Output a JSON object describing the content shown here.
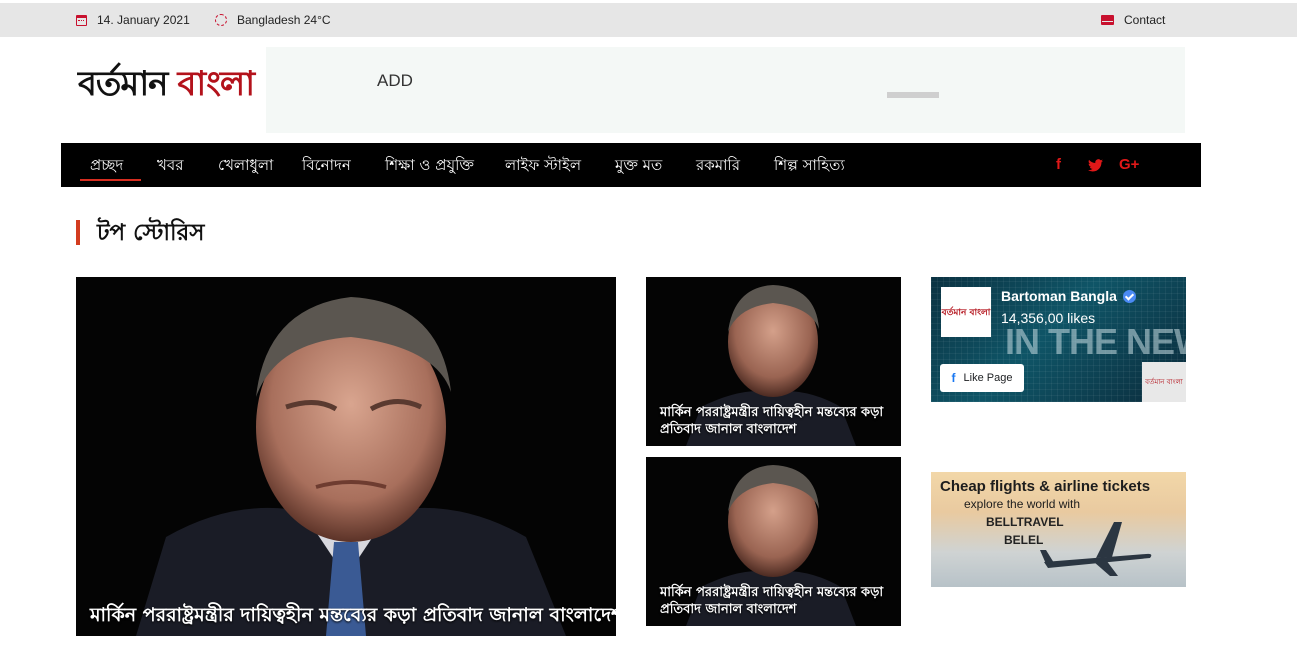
{
  "topbar": {
    "date": "14. January 2021",
    "weather": "Bangladesh 24°C",
    "contact": "Contact"
  },
  "header": {
    "logo_part1": "বর্তমান",
    "logo_part2": "বাংলা",
    "ad_text": "ADD"
  },
  "nav": {
    "items": [
      "প্রচ্ছদ",
      "খবর",
      "খেলাধুলা",
      "বিনোদন",
      "শিক্ষা ও প্রযুক্তি",
      "লাইফ স্টাইল",
      "মুক্ত মত",
      "রকমারি",
      "শিল্প সাহিত্য"
    ],
    "social": [
      "f",
      "t",
      "G+"
    ]
  },
  "section": {
    "title": "টপ স্টোরিস"
  },
  "stories": [
    {
      "headline": "মার্কিন পররাষ্ট্রমন্ত্রীর দায়িত্বহীন মন্তব্যের কড়া প্রতিবাদ জানাল বাংলাদেশ"
    },
    {
      "headline": "মার্কিন পররাষ্ট্রমন্ত্রীর দায়িত্বহীন মন্তব্যের কড়া প্রতিবাদ জানাল বাংলাদেশ"
    },
    {
      "headline": "মার্কিন পররাষ্ট্রমন্ত্রীর দায়িত্বহীন মন্তব্যের কড়া প্রতিবাদ জানাল বাংলাদেশ"
    }
  ],
  "facebook": {
    "page_name": "Bartoman Bangla",
    "likes": "14,356,00 likes",
    "like_button": "Like Page",
    "background_text": "IN THE NEWS",
    "thumb_text": "বর্তমান বাংলা"
  },
  "travel_ad": {
    "title": "Cheap flights & airline tickets",
    "subtitle": "explore the world with",
    "brand_line1": "BELLTRAVEL",
    "brand_line2": "BELEL"
  },
  "colors": {
    "accent": "#c8102e",
    "nav_bg": "#000000",
    "topbar_bg": "#e6e6e6"
  }
}
